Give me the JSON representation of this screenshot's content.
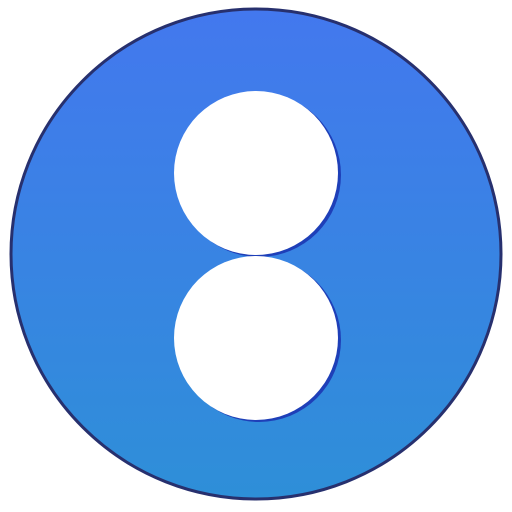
{
  "icon": {
    "name": "two-circles-app-icon",
    "colors": {
      "gradient_top": "#4378EE",
      "gradient_bottom": "#2E8FD8",
      "outline": "#27306E",
      "glyph_fill": "#FFFFFF",
      "glyph_edge": "#1E3FB8"
    }
  }
}
